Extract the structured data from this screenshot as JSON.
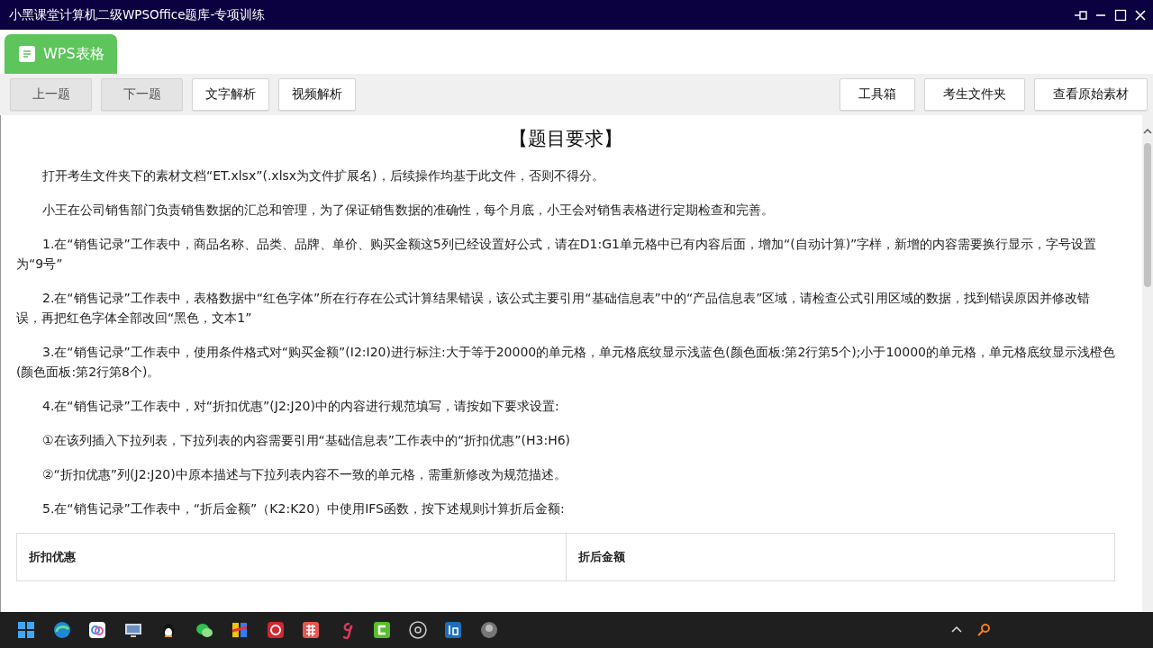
{
  "window": {
    "title": "小黑课堂计算机二级WPSOffice题库-专项训练"
  },
  "tabs": [
    {
      "label": "WPS表格",
      "selected": true
    }
  ],
  "toolbar": {
    "left": [
      {
        "label": "上一题",
        "disabled": true
      },
      {
        "label": "下一题",
        "disabled": true
      },
      {
        "label": "文字解析",
        "disabled": false
      },
      {
        "label": "视频解析",
        "disabled": false
      }
    ],
    "right": [
      {
        "label": "工具箱"
      },
      {
        "label": "考生文件夹"
      },
      {
        "label": "查看原始素材"
      }
    ]
  },
  "content": {
    "heading": "【题目要求】",
    "paragraphs": [
      "打开考生文件夹下的素材文档“ET.xlsx”(.xlsx为文件扩展名)，后续操作均基于此文件，否则不得分。",
      "小王在公司销售部门负责销售数据的汇总和管理，为了保证销售数据的准确性，每个月底，小王会对销售表格进行定期检查和完善。",
      "1.在“销售记录”工作表中，商品名称、品类、品牌、单价、购买金额这5列已经设置好公式，请在D1:G1单元格中已有内容后面，增加“(自动计算)”字样，新增的内容需要换行显示，字号设置为“9号”",
      "2.在“销售记录”工作表中，表格数据中“红色字体”所在行存在公式计算结果错误，该公式主要引用“基础信息表”中的“产品信息表”区域，请检查公式引用区域的数据，找到错误原因并修改错误，再把红色字体全部改回“黑色，文本1”",
      "3.在“销售记录”工作表中，使用条件格式对“购买金额”(I2:I20)进行标注:大于等于20000的单元格，单元格底纹显示浅蓝色(颜色面板:第2行第5个);小于10000的单元格，单元格底纹显示浅橙色(颜色面板:第2行第8个)。",
      "4.在“销售记录”工作表中，对“折扣优惠”(J2:J20)中的内容进行规范填写，请按如下要求设置:",
      "①在该列插入下拉列表，下拉列表的内容需要引用“基础信息表”工作表中的“折扣优惠”(H3:H6)",
      "②“折扣优惠”列(J2:J20)中原本描述与下拉列表内容不一致的单元格，需重新修改为规范描述。",
      "5.在“销售记录”工作表中，“折后金额”（K2:K20）中使用IFS函数，按下述规则计算折后金额:"
    ],
    "table": {
      "columns": [
        "折扣优惠",
        "折后金额"
      ]
    }
  }
}
